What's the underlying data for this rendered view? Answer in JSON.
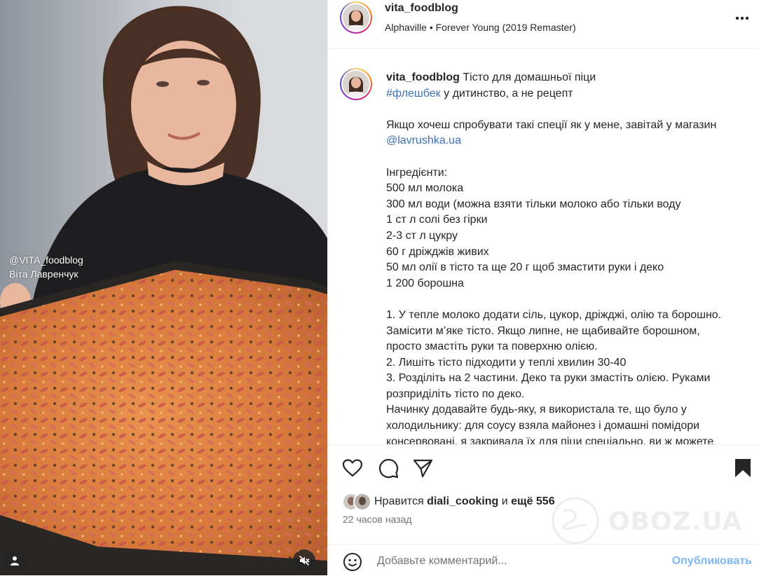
{
  "media": {
    "watermark_handle": "@VITA_foodblog",
    "watermark_name": "Віта Лавренчук",
    "user_icon": "user-tag-icon",
    "mute_icon": "speaker-muted-icon"
  },
  "header": {
    "username": "vita_foodblog",
    "music_artist": "Alphaville",
    "music_separator": "•",
    "music_track": "Forever Young (2019 Remaster)",
    "more_icon": "more-horizontal-icon"
  },
  "caption": {
    "username": "vita_foodblog",
    "title": "Тісто для домашньої піци",
    "hashtag": "#флешбек",
    "line2_rest": " у дитинство, а не рецепт",
    "shop_text": "Якщо хочеш спробувати такі спеції як у мене, завітай у магазин",
    "shop_mention": "@lavrushka.ua",
    "ingredients_title": "Інгредієнти:",
    "ingredients": [
      "500 мл молока",
      "300 мл води (можна взяти тільки молоко або тільки воду",
      "1 ст л солі без гірки",
      "2-3 ст л цукру",
      "60 г дріжджів живих",
      "50 мл олії в тісто та ще 20 г щоб змастити руки і деко",
      "1 200 борошна"
    ],
    "steps": [
      "1. У тепле молоко додати сіль, цукор, дріжджі, олію та борошно.",
      "Замісити м’яке тісто. Якщо липне, не щабивайте борошном,",
      "просто змастіть руки та поверхню олією.",
      "2. Лишіть тісто підходити у теплі хвилин 30-40",
      "3. Розділіть на 2 частини. Деко та руки змастіть олією. Руками",
      "розприділіть тісто по деко.",
      "Начинку додавайте будь-яку, я використала те, що було у",
      "холодильнику: для соусу взяла майонез і домашні помідори",
      "консервовані, я закривала їх для піци спеціально, ви ж можете"
    ]
  },
  "actions": {
    "like_icon": "heart-icon",
    "comment_icon": "comment-icon",
    "share_icon": "send-icon",
    "save_icon": "bookmark-icon"
  },
  "likes": {
    "prefix": "Нравится",
    "user": "diali_cooking",
    "middle": "и",
    "more": "ещё 556"
  },
  "timestamp": "22 часов назад",
  "comment": {
    "emoji_icon": "emoji-icon",
    "placeholder": "Добавьте комментарий...",
    "publish": "Опубликовать"
  },
  "site_watermark": "OBOZ.UA",
  "colors": {
    "link": "#3b6fb6",
    "publish": "#7fb7f3",
    "muted_text": "#737373",
    "divider": "#efefef"
  }
}
